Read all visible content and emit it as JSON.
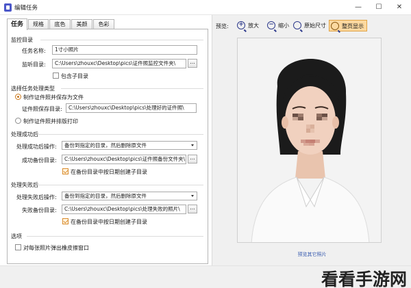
{
  "window": {
    "title": "编辑任务",
    "minimize_icon": "—",
    "maximize_icon": "☐",
    "close_icon": "✕"
  },
  "tabs": [
    "任务",
    "规格",
    "底色",
    "美颜",
    "色彩"
  ],
  "monitor_group": {
    "title": "监控目录",
    "task_name_label": "任务名称:",
    "task_name_value": "1寸小照片",
    "monitor_dir_label": "监听目录:",
    "monitor_dir_value": "C:\\Users\\zhouxc\\Desktop\\pics\\证件照监控文件夹\\",
    "include_subdir_label": "包含子目录",
    "include_subdir_checked": false
  },
  "task_type_group": {
    "title": "选择任务处理类型",
    "option_save_label": "制作证件照并保存为文件",
    "option_save_selected": true,
    "save_dir_label": "证件照保存目录:",
    "save_dir_value": "C:\\Users\\zhouxc\\Desktop\\pics\\处理好的证件照\\",
    "option_print_label": "制作证件照并排版打印",
    "option_print_selected": false
  },
  "success_group": {
    "title": "处理成功后",
    "action_label": "处理成功后操作:",
    "action_value": "备份到指定的目录，然后删除原文件",
    "backup_dir_label": "成功备份目录:",
    "backup_dir_value": "C:\\Users\\zhouxc\\Desktop\\pics\\证件照备份文件夹\\",
    "date_subdir_label": "在备份目录中按日期创建子目录",
    "date_subdir_checked": true
  },
  "fail_group": {
    "title": "处理失败后",
    "action_label": "处理失败后操作:",
    "action_value": "备份到指定的目录，然后删除原文件",
    "backup_dir_label": "失败备份目录:",
    "backup_dir_value": "C:\\Users\\zhouxc\\Desktop\\pics\\处理失败的照片\\",
    "date_subdir_label": "在备份目录中按日期创建子目录",
    "date_subdir_checked": true
  },
  "options_group": {
    "title": "选项",
    "popup_label": "对每张照片弹出橡皮擦窗口",
    "popup_checked": false
  },
  "browse_label": "...",
  "preview": {
    "label": "预览:",
    "zoom_in": "放大",
    "zoom_out": "缩小",
    "original_size": "原始尺寸",
    "fit_page": "整页显示",
    "preview_other_link": "预览其它照片"
  },
  "watermark": "看看手游网",
  "icons": {
    "zoom_in": "zoom-in-icon",
    "zoom_out": "zoom-out-icon",
    "original": "search-icon",
    "fit": "fit-page-icon"
  },
  "colors": {
    "accent_orange": "#fcd9a0",
    "link_blue": "#3a5db0",
    "app_icon": "#4b57c9"
  }
}
